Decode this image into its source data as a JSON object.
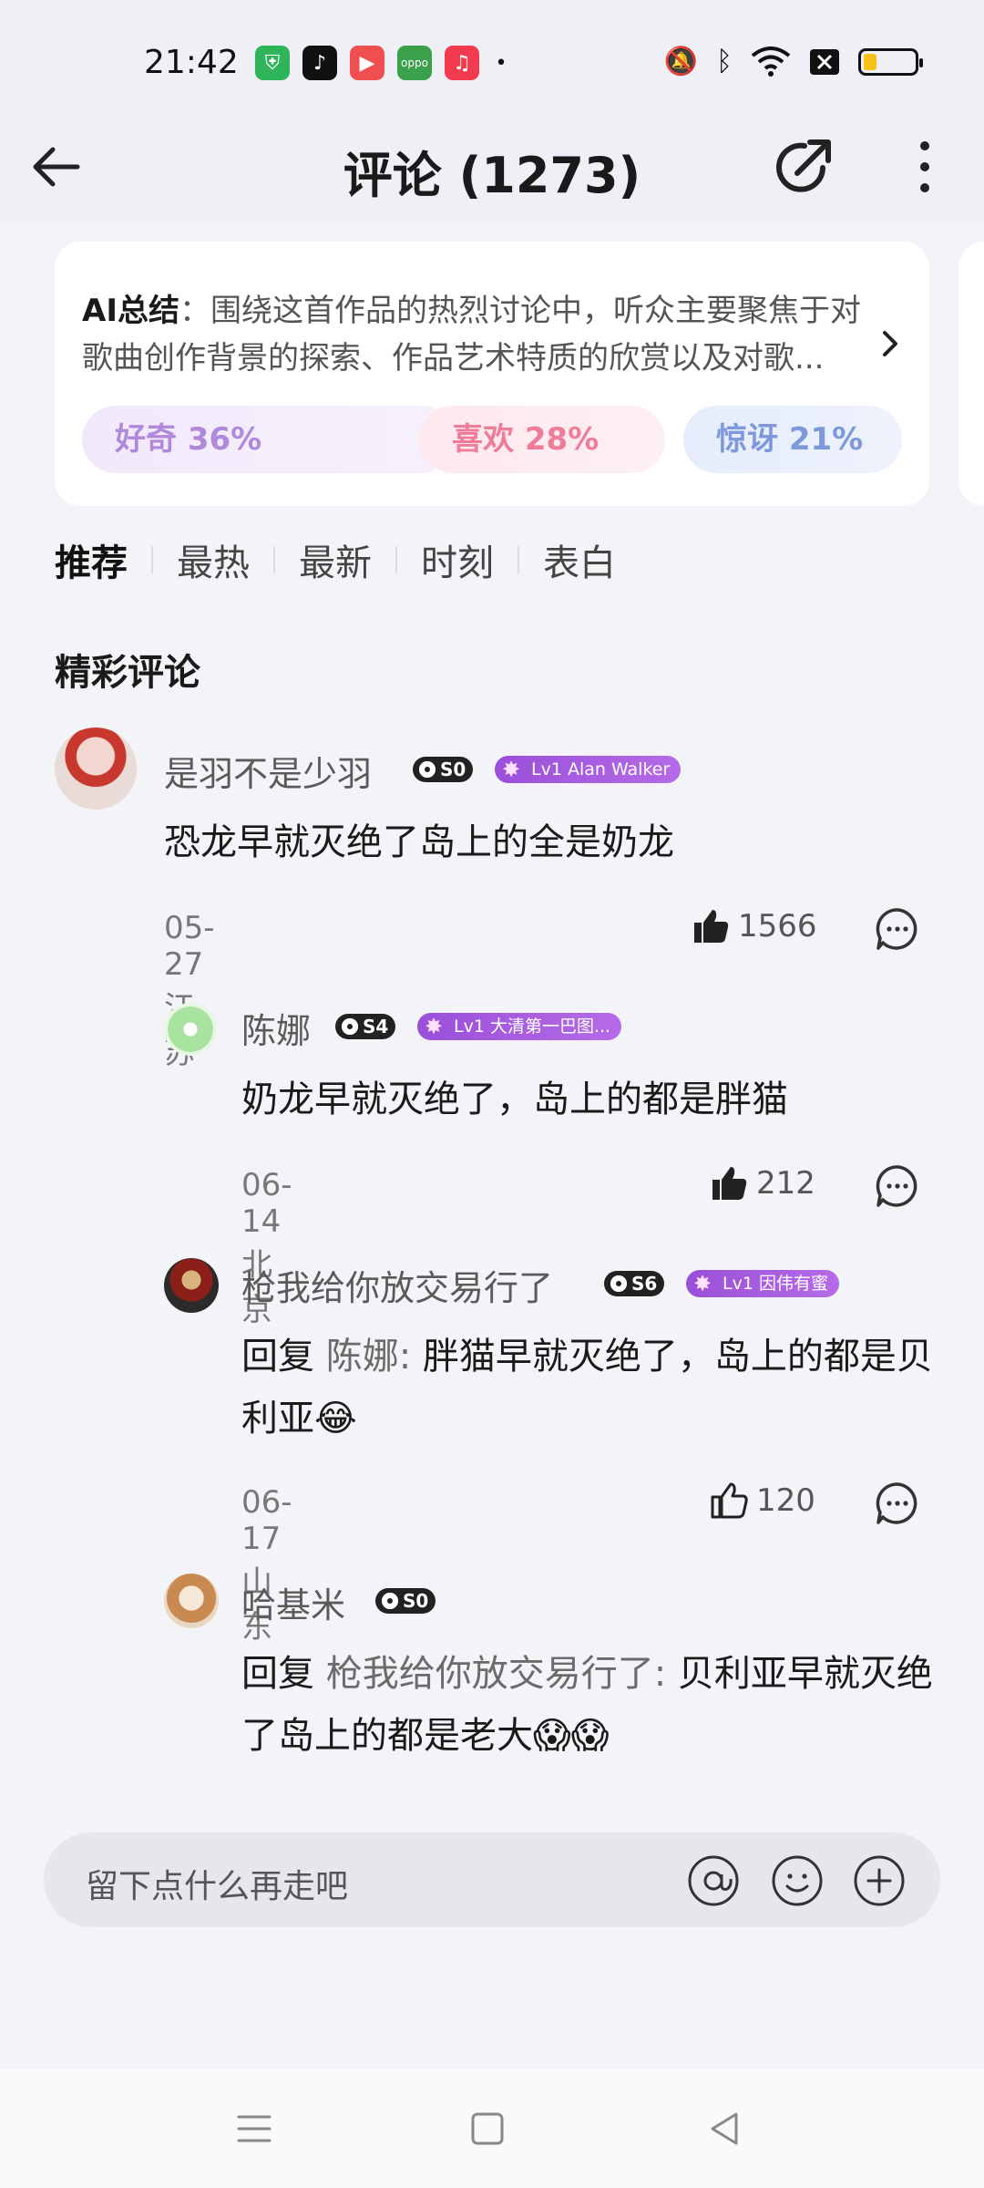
{
  "status_bar": {
    "time": "21:42"
  },
  "header": {
    "title": "评论 (1273)"
  },
  "ai_summary": {
    "label": "AI总结",
    "text": "：围绕这首作品的热烈讨论中，听众主要聚焦于对歌曲创作背景的探索、作品艺术特质的欣赏以及对歌...",
    "chips": [
      {
        "label": "好奇 36%"
      },
      {
        "label": "喜欢 28%"
      },
      {
        "label": "惊讶 21%"
      }
    ]
  },
  "tabs": [
    "推荐",
    "最热",
    "最新",
    "时刻",
    "表白"
  ],
  "section_title": "精彩评论",
  "comments": [
    {
      "user": "是羽不是少羽",
      "s_badge": "S0",
      "lv_badge": "Lv1 Alan Walker",
      "text": "恐龙早就灭绝了岛上的全是奶龙",
      "meta": "05-27 江苏",
      "likes": "1566"
    },
    {
      "user": "陈娜",
      "s_badge": "S4",
      "lv_badge": "Lv1 大清第一巴图...",
      "text": "奶龙早就灭绝了，岛上的都是胖猫",
      "meta": "06-14 北京",
      "likes": "212"
    },
    {
      "user": "枪我给你放交易行了",
      "s_badge": "S6",
      "lv_badge": "Lv1 因伟有蜜",
      "reply_prefix": "回复",
      "reply_to": " 陈娜: ",
      "text": "胖猫早就灭绝了，岛上的都是贝利亚😂",
      "meta": "06-17 山东",
      "likes": "120"
    },
    {
      "user": "哈基米",
      "s_badge": "S0",
      "reply_prefix": "回复",
      "reply_to": " 枪我给你放交易行了: ",
      "text": "贝利亚早就灭绝了岛上的都是老大😱😱"
    }
  ],
  "input": {
    "placeholder": "留下点什么再走吧"
  }
}
